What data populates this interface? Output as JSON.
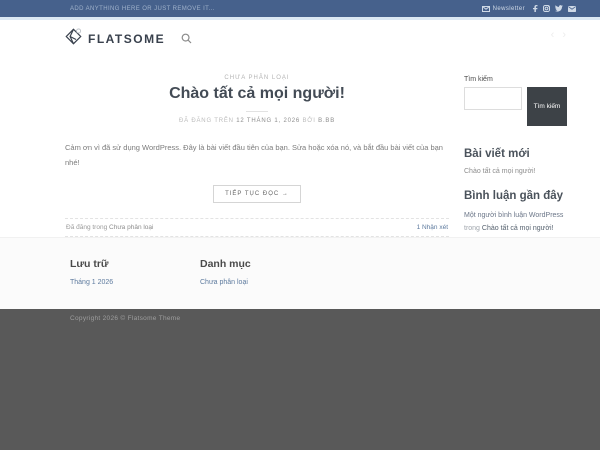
{
  "topbar": {
    "left_text": "ADD ANYTHING HERE OR JUST REMOVE IT...",
    "newsletter_label": "Newsletter",
    "social_icons": [
      "mail-icon",
      "facebook-icon",
      "instagram-icon",
      "twitter-icon",
      "email-icon"
    ]
  },
  "header": {
    "logo_text": "FLATSOME",
    "search_icon": "search-icon",
    "prev_arrow": "‹",
    "next_arrow": "›"
  },
  "post": {
    "category": "CHƯA PHÂN LOẠI",
    "title": "Chào tất cả mọi người!",
    "meta_prefix": "ĐÃ ĐĂNG TRÊN",
    "meta_date": "12 THÁNG 1, 2026",
    "meta_by": "BỞI",
    "meta_author": "B.BB",
    "excerpt": "Cảm ơn vì đã sử dụng WordPress. Đây là bài viết đầu tiên của bạn. Sửa hoặc xóa nó, và bắt đầu bài viết của bạn nhé!",
    "read_more_label": "TIẾP TỤC ĐỌC",
    "read_more_arrow": "→",
    "posted_in_label": "Đã đăng trong",
    "posted_in_category": "Chưa phân loại",
    "comments_link": "1 Nhận xét"
  },
  "sidebar": {
    "search_label": "Tìm kiếm",
    "search_input_value": "",
    "search_button_label": "Tìm kiếm",
    "recent_posts_title": "Bài viết mới",
    "recent_posts": [
      "Chào tất cả mọi người!"
    ],
    "recent_comments_title": "Bình luận gần đây",
    "comment_author": "Một người bình luận WordPress",
    "comment_connector": "trong",
    "comment_post": "Chào tất cả mọi người!"
  },
  "footer": {
    "archives_title": "Lưu trữ",
    "archives_link": "Tháng 1 2026",
    "categories_title": "Danh mục",
    "categories_link": "Chưa phân loại",
    "copyright": "Copyright 2026 © Flatsome Theme"
  },
  "colors": {
    "topbar_bg": "#46618c",
    "topbar_accent": "#dbe8f4",
    "logo_text": "#39414d",
    "heading": "#434b55",
    "body_text": "#7b7b7b",
    "link": "#5d7a9e",
    "search_button_bg": "#3d4247",
    "footer_dark_bg": "#595959"
  }
}
